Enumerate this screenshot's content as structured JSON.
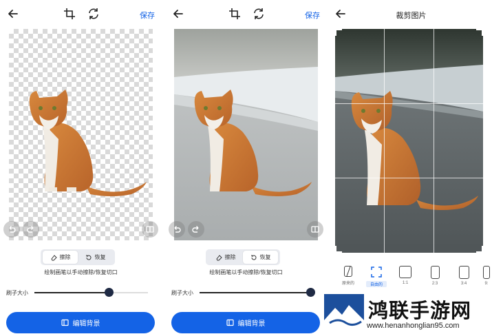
{
  "panel_edit_erase": {
    "save_label": "保存",
    "seg_erase_label": "擦除",
    "seg_restore_label": "恢复",
    "seg_selected": "erase",
    "hint": "绘制画笔以手动擦除/恢复切口",
    "brush_label": "刷子大小",
    "brush_size": 0.66,
    "edit_bg_label": "编辑背景",
    "icons": [
      "back-arrow-icon",
      "crop-icon",
      "rotate-icon",
      "undo-icon",
      "redo-icon",
      "compare-icon",
      "eraser-icon",
      "restore-icon",
      "image-edit-icon"
    ]
  },
  "panel_edit_restore": {
    "save_label": "保存",
    "seg_erase_label": "擦除",
    "seg_restore_label": "恢复",
    "seg_selected": "restore",
    "hint": "绘制画笔以手动擦除/恢复切口",
    "brush_label": "刷子大小",
    "brush_size": 0.98,
    "edit_bg_label": "编辑背景"
  },
  "panel_crop": {
    "title": "裁剪图片",
    "ratios": [
      {
        "label": "原来的"
      },
      {
        "label": "自由的"
      },
      {
        "label": "1:1"
      },
      {
        "label": "2:3"
      },
      {
        "label": "3:4"
      },
      {
        "label": "9:"
      }
    ],
    "selected_ratio": "自由的"
  },
  "watermark": {
    "brand": "鸿联手游网",
    "url": "www.henanhonglian95.com"
  },
  "colors": {
    "accent": "#1463e6",
    "knob": "#1f2a44",
    "segment_bg": "#e9ebf0"
  }
}
